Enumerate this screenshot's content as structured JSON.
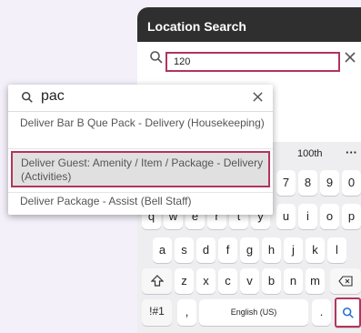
{
  "header": {
    "title": "Location Search"
  },
  "search": {
    "value": "120"
  },
  "popup": {
    "query": "pac",
    "options": [
      {
        "label": "Deliver Bar B Que Pack - Delivery (Housekeeping)"
      },
      {
        "label": "Deliver Guest: Amenity / Item / Package - Delivery (Activities)"
      },
      {
        "label": "Deliver Package - Assist (Bell Staff)"
      }
    ]
  },
  "keyboard": {
    "suggestion": "100th",
    "more": "···",
    "row_top": [
      "7",
      "8",
      "9",
      "0"
    ],
    "row_q": [
      "q",
      "w",
      "e",
      "r",
      "t",
      "y",
      "u",
      "i",
      "o",
      "p"
    ],
    "row_a": [
      "a",
      "s",
      "d",
      "f",
      "g",
      "h",
      "j",
      "k",
      "l"
    ],
    "row_z": [
      "z",
      "x",
      "c",
      "v",
      "b",
      "n",
      "m"
    ],
    "symbols_label": "!#1",
    "comma": ",",
    "space_label": "English (US)",
    "period": "."
  },
  "colors": {
    "header_bg": "#2f2f2f",
    "accent": "#b0355c",
    "selected_bg": "#e0e0e0"
  },
  "icons": [
    "search-icon",
    "close-icon",
    "shift-icon",
    "backspace-icon"
  ]
}
